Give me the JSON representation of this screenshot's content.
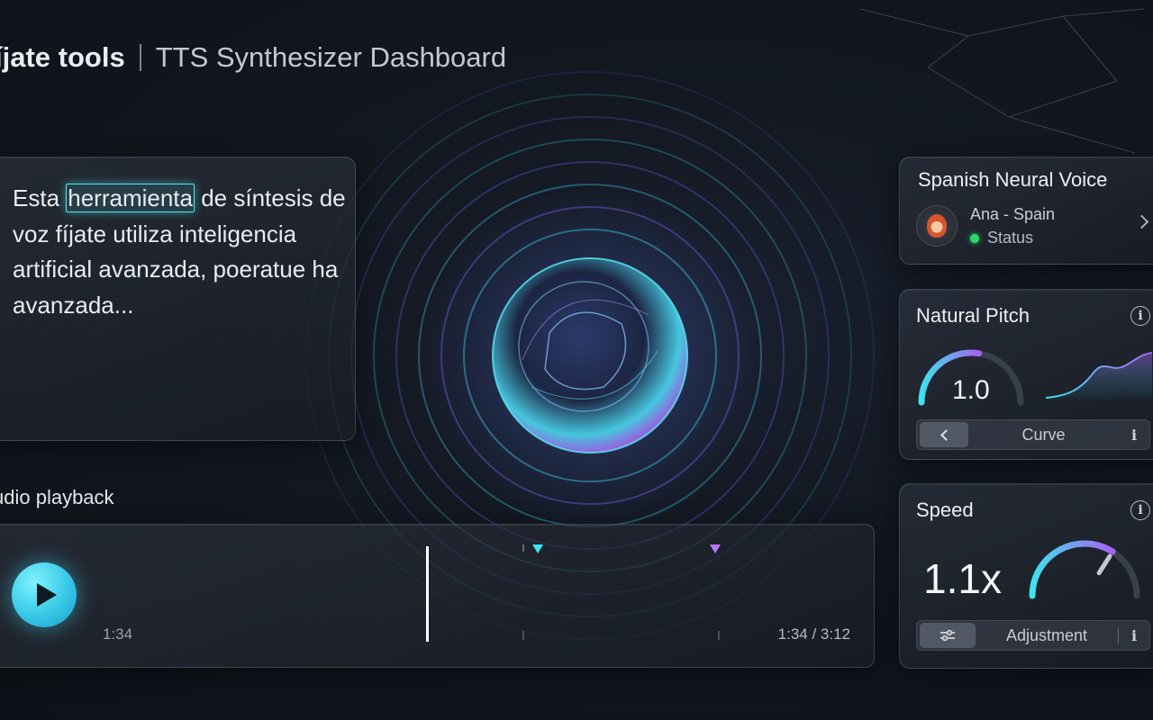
{
  "header": {
    "brand": "íjate tools",
    "subtitle": "TTS Synthesizer Dashboard"
  },
  "editor": {
    "text_before": "Esta ",
    "highlighted_word": "herramienta",
    "text_after": " de síntesis de voz fíjate utiliza inteligencia artificial avanzada, poeratue ha avanzada..."
  },
  "playback": {
    "label": "udio playback",
    "current_time": "1:34",
    "time_readout": "1:34 / 3:12",
    "progress_fraction": 0.43,
    "play_icon": "play-icon"
  },
  "voice": {
    "title": "Spanish Neural Voice",
    "name": "Ana - Spain",
    "status": "Status",
    "status_color": "#2fd86a"
  },
  "pitch": {
    "title": "Natural Pitch",
    "value": "1.0",
    "gauge_fraction": 0.55,
    "control_label": "Curve",
    "info_glyph": "i"
  },
  "speed": {
    "title": "Speed",
    "value": "1.1x",
    "gauge_fraction": 0.68,
    "control_label": "Adjustment",
    "info_glyph": "i"
  },
  "colors": {
    "accent_cyan": "#3fe2ee",
    "accent_purple": "#a463f0",
    "background": "#131821"
  }
}
